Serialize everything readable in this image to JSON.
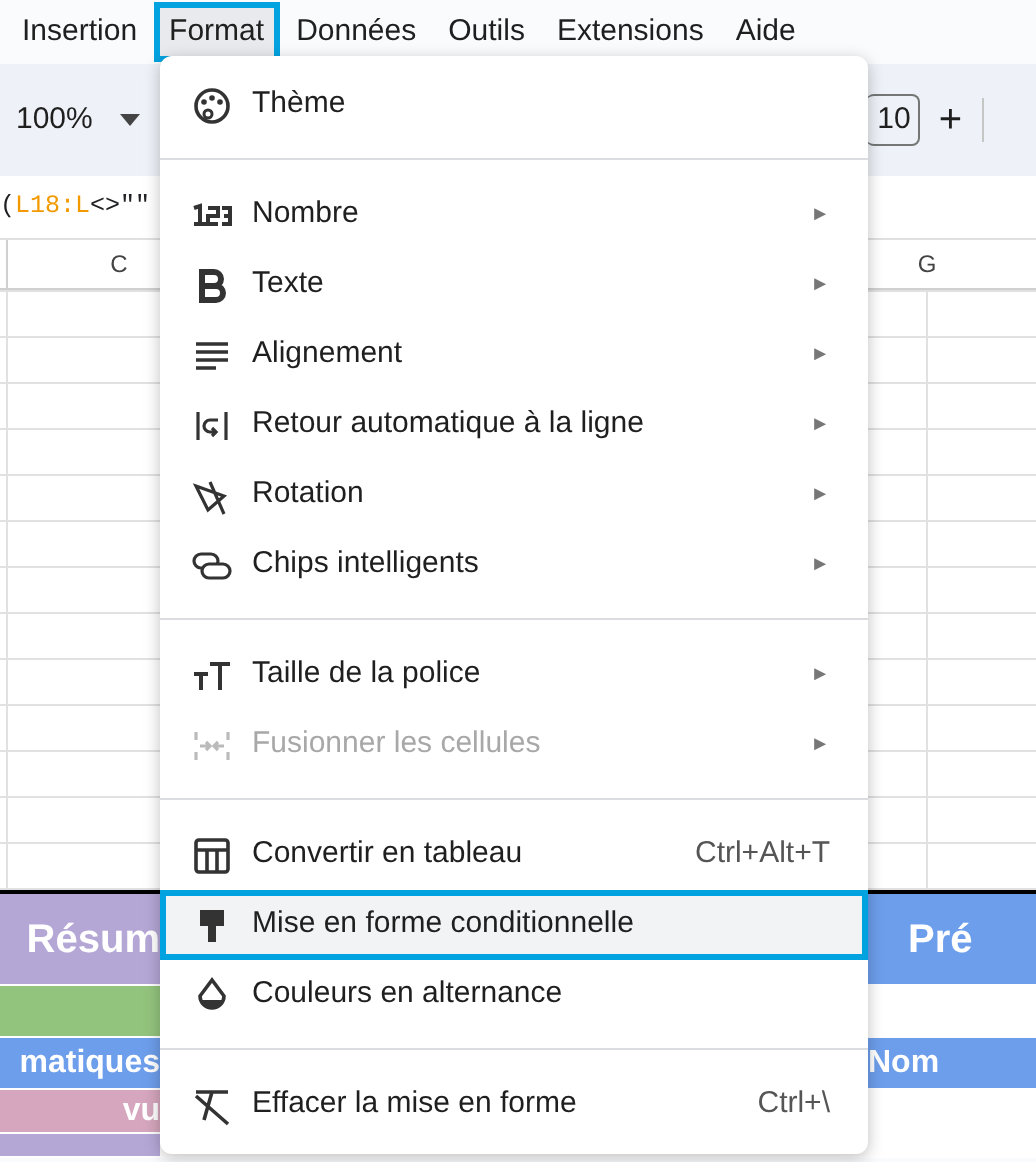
{
  "menubar": [
    {
      "label": "Insertion",
      "selected": false
    },
    {
      "label": "Format",
      "selected": true
    },
    {
      "label": "Données",
      "selected": false
    },
    {
      "label": "Outils",
      "selected": false
    },
    {
      "label": "Extensions",
      "selected": false
    },
    {
      "label": "Aide",
      "selected": false
    }
  ],
  "toolbar": {
    "zoom": "100%",
    "font_size": "10",
    "plus": "+"
  },
  "formula": [
    {
      "text": "(",
      "color": "#202124"
    },
    {
      "text": "L18:L",
      "color": "#f29900"
    },
    {
      "text": "<>\"\"",
      "color": "#202124"
    }
  ],
  "column_headers": [
    "C",
    "G"
  ],
  "sheet_rows": [
    {
      "cells": [
        {
          "text": "Résum",
          "color": "#b4a7d6"
        },
        {
          "text": "Pré",
          "color": "#6d9eeb"
        }
      ]
    },
    {
      "cells": [
        {
          "color": "#93c47d"
        }
      ]
    },
    {
      "cells": [
        {
          "text": "matiques",
          "color": "#6d9eeb"
        },
        {
          "text": "Nom",
          "color": "#6d9eeb"
        }
      ]
    },
    {
      "cells": [
        {
          "text": "vu",
          "color": "#d5a6bd"
        }
      ]
    },
    {
      "cells": [
        {
          "color": "#b4a7d6"
        }
      ]
    }
  ],
  "menu": [
    {
      "kind": "item",
      "label": "Thème",
      "disabled": false,
      "selected": false
    },
    {
      "kind": "separator"
    },
    {
      "kind": "item",
      "label": "Nombre",
      "arrow": "►",
      "disabled": false,
      "selected": false
    },
    {
      "kind": "item",
      "label": "Texte",
      "arrow": "►",
      "disabled": false,
      "selected": false
    },
    {
      "kind": "item",
      "label": "Alignement",
      "arrow": "►",
      "disabled": false,
      "selected": false
    },
    {
      "kind": "item",
      "label": "Retour automatique à la ligne",
      "arrow": "►",
      "disabled": false,
      "selected": false
    },
    {
      "kind": "item",
      "label": "Rotation",
      "arrow": "►",
      "disabled": false,
      "selected": false
    },
    {
      "kind": "item",
      "label": "Chips intelligents",
      "arrow": "►",
      "disabled": false,
      "selected": false
    },
    {
      "kind": "separator"
    },
    {
      "kind": "item",
      "label": "Taille de la police",
      "arrow": "►",
      "disabled": false,
      "selected": false
    },
    {
      "kind": "item",
      "label": "Fusionner les cellules",
      "arrow": "►",
      "disabled": true,
      "selected": false
    },
    {
      "kind": "separator"
    },
    {
      "kind": "item",
      "label": "Convertir en tableau",
      "shortcut": "Ctrl+Alt+T",
      "disabled": false,
      "selected": false
    },
    {
      "kind": "item",
      "label": "Mise en forme conditionnelle",
      "disabled": false,
      "selected": true
    },
    {
      "kind": "item",
      "label": "Couleurs en alternance",
      "disabled": false,
      "selected": false
    },
    {
      "kind": "separator"
    },
    {
      "kind": "item",
      "label": "Effacer la mise en forme",
      "shortcut": "Ctrl+\\",
      "disabled": false,
      "selected": false
    }
  ]
}
